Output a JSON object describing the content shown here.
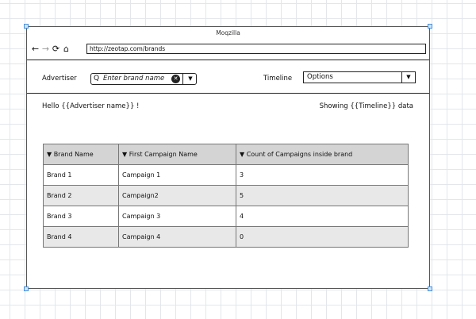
{
  "browser": {
    "title": "Moqzilla",
    "nav": {
      "back": "←",
      "forward": "→",
      "reload": "⟳",
      "home": "⌂"
    },
    "url": "http://zeotap.com/brands"
  },
  "filters": {
    "advertiser_label": "Advertiser",
    "search_icon": "Q",
    "brand_placeholder": "Enter brand name",
    "clear_icon": "✕",
    "dropdown_icon": "▼",
    "timeline_label": "Timeline",
    "timeline_value": "Options"
  },
  "header": {
    "greeting": "Hello {{Advertiser name}} !",
    "showing": "Showing {{Timeline}} data"
  },
  "table": {
    "columns": [
      "▼ Brand Name",
      "▼ First Campaign Name",
      "▼ Count of Campaigns inside brand"
    ],
    "rows": [
      [
        "Brand 1",
        "Campaign 1",
        "3"
      ],
      [
        "Brand 2",
        "Campaign2",
        "5"
      ],
      [
        "Brand 3",
        "Campaign 3",
        "4"
      ],
      [
        "Brand 4",
        "Campaign 4",
        "0"
      ]
    ]
  }
}
